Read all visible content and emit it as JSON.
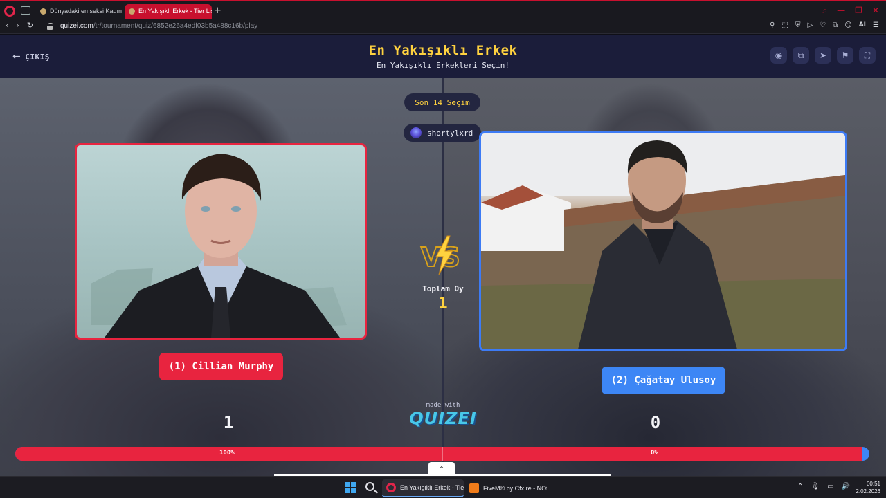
{
  "browser": {
    "tabs": [
      {
        "label": "Dünyadaki en seksi Kadın"
      },
      {
        "label": "En Yakışıklı Erkek - Tier Lis"
      }
    ],
    "new_tab": "+",
    "url_host": "quizei.com",
    "url_path": "/tr/tournament/quiz/6852e26a4edf03b5a488c16b/play",
    "ai_label": "AI"
  },
  "header": {
    "exit_label": "ÇIKIŞ",
    "title": "En Yakışıklı Erkek",
    "subtitle": "En Yakışıklı Erkekleri Seçin!",
    "icons": [
      "eye-icon",
      "share-icon",
      "send-icon",
      "flag-icon",
      "fullscreen-icon"
    ]
  },
  "arena": {
    "round_label": "Son 14 Seçim",
    "username": "shortylxrd",
    "vs_label": "VS",
    "total_votes_label": "Toplam Oy",
    "total_votes": "1",
    "left": {
      "name": "(1) Cillian Murphy",
      "score": "1",
      "percent_label": "100%",
      "percent": 100,
      "color": "#e8243f"
    },
    "right": {
      "name": "(2) Çağatay Ulusoy",
      "score": "0",
      "percent_label": "0%",
      "percent": 0,
      "color": "#3d86f5"
    },
    "made_with": "made with",
    "brand": "QUIZEI"
  },
  "taskbar": {
    "apps": [
      {
        "label": "En Yakışıklı Erkek - Tier l"
      },
      {
        "label": "FiveM® by Cfx.re - NOt"
      }
    ],
    "time": "00:51",
    "date": "2.02.2026"
  }
}
